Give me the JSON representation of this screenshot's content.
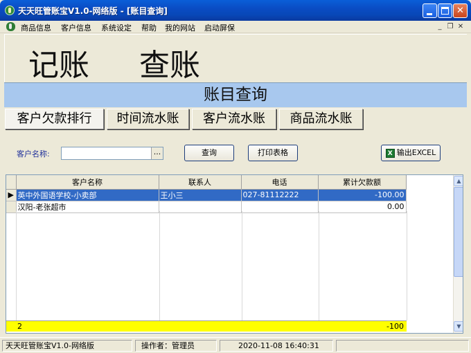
{
  "window": {
    "title": "天天旺管账宝V1.0-网络版 - [账目查询]"
  },
  "menu": {
    "items": [
      "商品信息",
      "客户信息",
      "系统设定",
      "帮助",
      "我的网站",
      "启动屏保"
    ]
  },
  "big_buttons": {
    "bookkeeping": "记账",
    "query": "查账"
  },
  "panel": {
    "title": "账目查询"
  },
  "tabs": [
    {
      "label": "客户欠款排行",
      "active": true
    },
    {
      "label": "时间流水账",
      "active": false
    },
    {
      "label": "客户流水账",
      "active": false
    },
    {
      "label": "商品流水账",
      "active": false
    }
  ],
  "filter": {
    "customer_label": "客户名称:",
    "customer_value": "",
    "ellipsis": "...",
    "query_button": "查询",
    "print_button": "打印表格",
    "export_button": "输出EXCEL"
  },
  "table": {
    "columns": [
      "客户名称",
      "联系人",
      "电话",
      "累计欠款额"
    ],
    "rows": [
      {
        "name": "英中外国语学校-小卖部",
        "contact": "王小三",
        "phone": "027-81112222",
        "debt": "-100.00",
        "selected": true
      },
      {
        "name": "汉阳-老张超市",
        "contact": "",
        "phone": "",
        "debt": "0.00",
        "selected": false
      }
    ],
    "total": {
      "count": "2",
      "debt": "-100"
    }
  },
  "status": {
    "app": "天天旺管账宝V1.0-网络版",
    "operator": "操作者：管理员",
    "datetime": "2020-11-08  16:40:31"
  },
  "colors": {
    "panel_header": "#a8c8ee",
    "selection": "#316ac5",
    "total_row": "#ffff00",
    "title_bar": "#0a4cc4"
  }
}
